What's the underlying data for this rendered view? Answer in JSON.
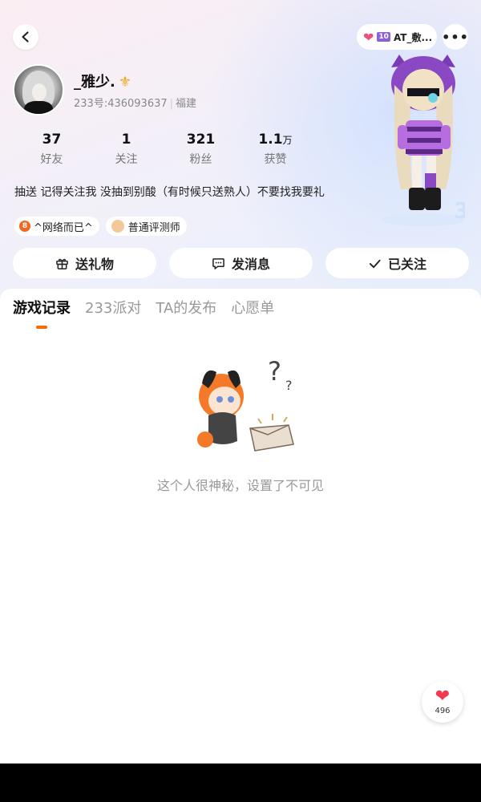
{
  "header": {
    "friend_pill": {
      "name": "AT_敷...",
      "badge": "10"
    }
  },
  "profile": {
    "name": "_雅少.",
    "id_text": "233号:436093637",
    "location": "福建",
    "stats": [
      {
        "value": "37",
        "unit": "",
        "label": "好友"
      },
      {
        "value": "1",
        "unit": "",
        "label": "关注"
      },
      {
        "value": "321",
        "unit": "",
        "label": "粉丝"
      },
      {
        "value": "1.1",
        "unit": "万",
        "label": "获赞"
      }
    ],
    "bio": "抽送 记得关注我 没抽到别酸（有时候只送熟人）不要找我要礼",
    "tags": [
      {
        "label": "^网络而已^"
      },
      {
        "label": "普通评测师"
      }
    ]
  },
  "actions": {
    "gift": "送礼物",
    "message": "发消息",
    "followed": "已关注"
  },
  "tabs": [
    {
      "label": "游戏记录",
      "active": true
    },
    {
      "label": "233派对",
      "active": false
    },
    {
      "label": "TA的发布",
      "active": false
    },
    {
      "label": "心愿单",
      "active": false
    }
  ],
  "empty_state": {
    "text": "这个人很神秘，设置了不可见"
  },
  "like_fab": {
    "count": "496"
  },
  "colors": {
    "accent": "#ff6a00",
    "heart": "#f03a4f"
  }
}
